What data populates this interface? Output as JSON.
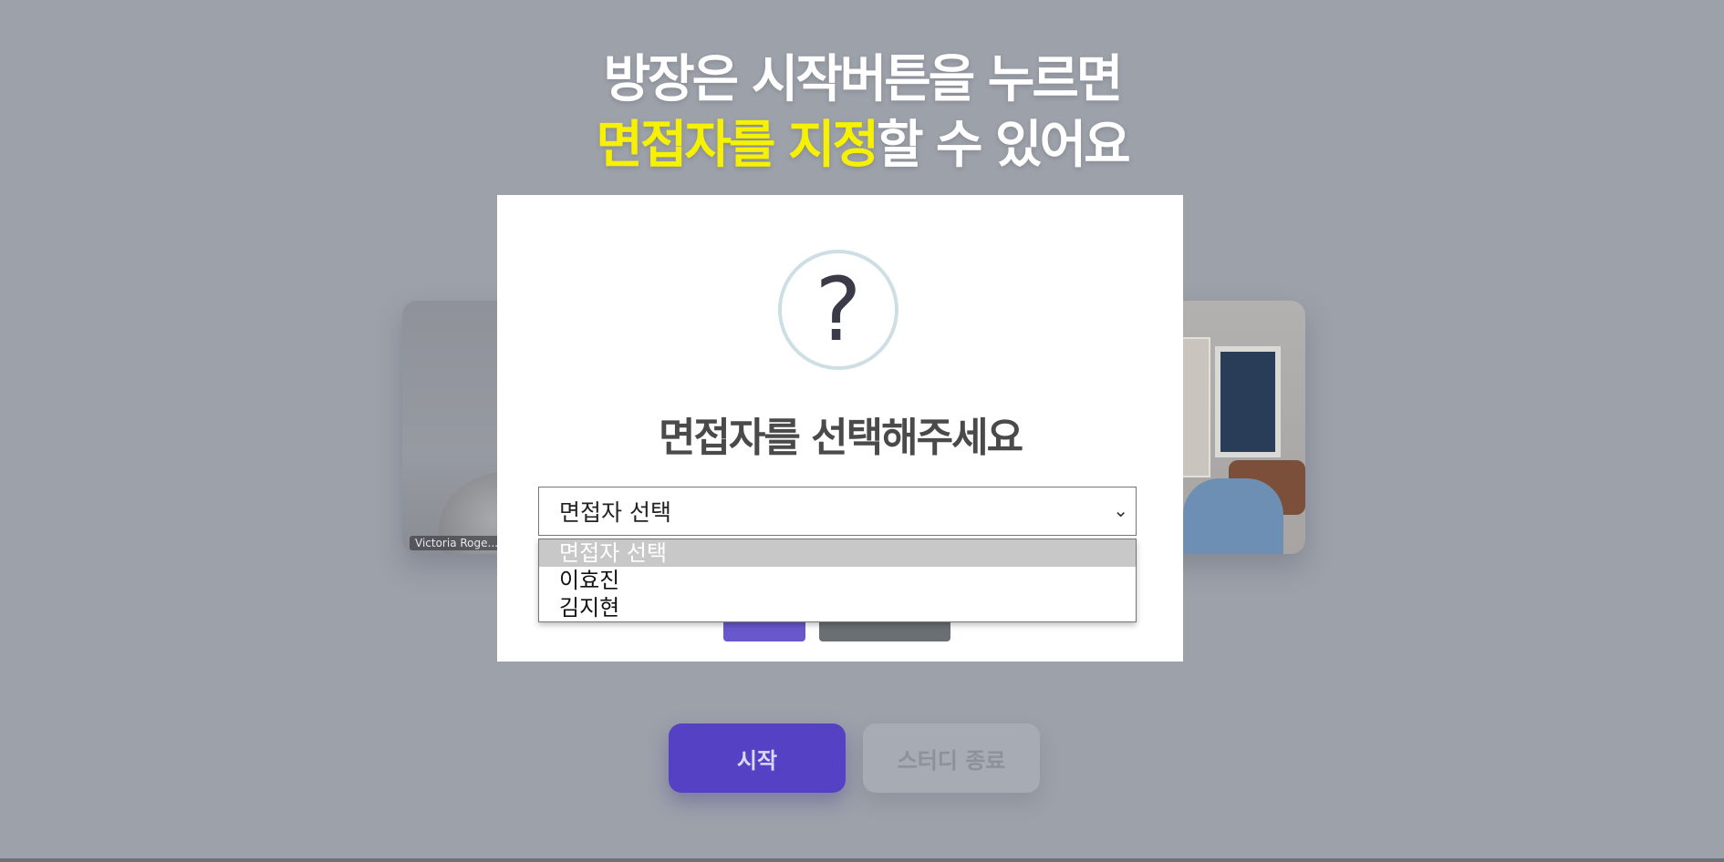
{
  "caption": {
    "line1": "방장은 시작버튼을 누르면",
    "line2_highlight": "면접자를 지정",
    "line2_rest": "할 수 있어요",
    "highlight_color": "#f6f100"
  },
  "video": {
    "left_name": "Victoria Roge..."
  },
  "actions": {
    "start_label": "시작",
    "end_label": "스터디 종료"
  },
  "modal": {
    "icon": "question-icon",
    "icon_glyph": "?",
    "title": "면접자를 선택해주세요",
    "select": {
      "value": "면접자 선택",
      "chevron": "⌄",
      "options": [
        {
          "label": "면접자 선택",
          "selected": true
        },
        {
          "label": "이효진",
          "selected": false
        },
        {
          "label": "김지현",
          "selected": false
        }
      ]
    }
  },
  "colors": {
    "overlay_background": "#9da1aa",
    "start_button": "#5541c4",
    "modal_background": "#ffffff"
  }
}
